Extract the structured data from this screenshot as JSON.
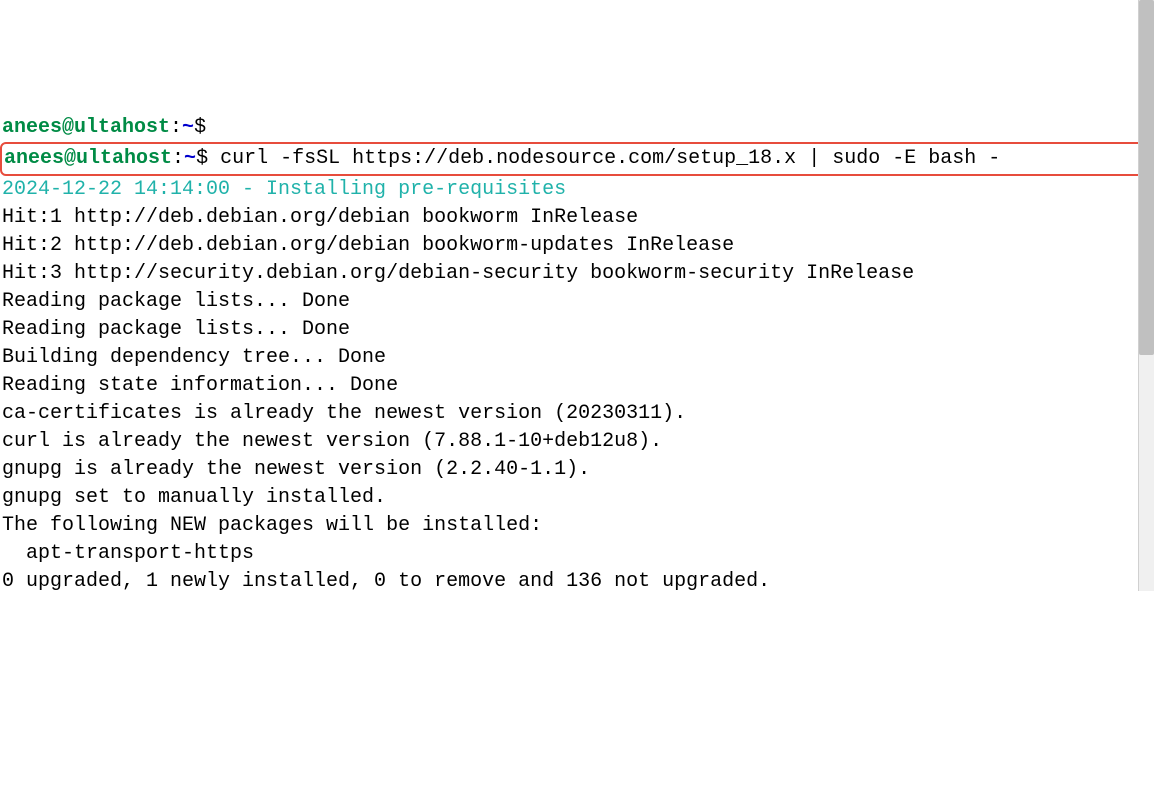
{
  "prompt": {
    "user": "anees@ultahost",
    "path": "~",
    "symbol": "$"
  },
  "command": "curl -fsSL https://deb.nodesource.com/setup_18.x | sudo -E bash -",
  "status_line": "2024-12-22 14:14:00 - Installing pre-requisites",
  "output_lines": [
    "Hit:1 http://deb.debian.org/debian bookworm InRelease",
    "Hit:2 http://deb.debian.org/debian bookworm-updates InRelease",
    "Hit:3 http://security.debian.org/debian-security bookworm-security InRelease",
    "Reading package lists... Done",
    "Reading package lists... Done",
    "Building dependency tree... Done",
    "Reading state information... Done",
    "ca-certificates is already the newest version (20230311).",
    "curl is already the newest version (7.88.1-10+deb12u8).",
    "gnupg is already the newest version (2.2.40-1.1).",
    "gnupg set to manually installed.",
    "The following NEW packages will be installed:",
    "  apt-transport-https",
    "0 upgraded, 1 newly installed, 0 to remove and 136 not upgraded."
  ]
}
